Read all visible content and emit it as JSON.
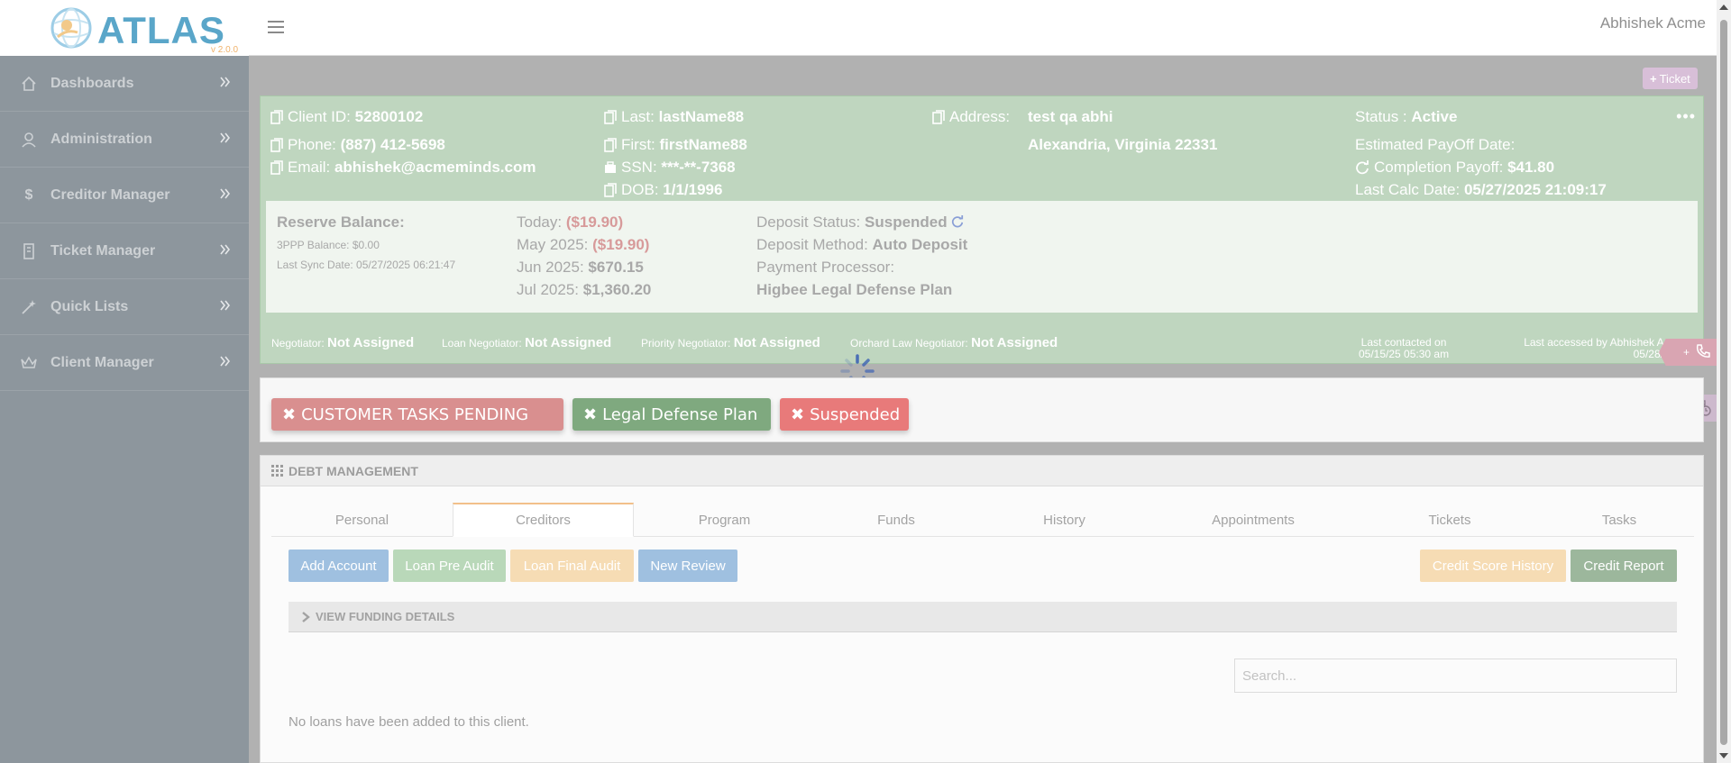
{
  "app": {
    "logo_text": "ATLAS",
    "version": "v 2.0.0"
  },
  "topbar": {
    "user_name": "Abhishek Acme"
  },
  "sidebar": {
    "items": [
      {
        "label": "Dashboards",
        "icon": "home-icon"
      },
      {
        "label": "Administration",
        "icon": "user-icon"
      },
      {
        "label": "Creditor Manager",
        "icon": "dollar-icon"
      },
      {
        "label": "Ticket Manager",
        "icon": "building-icon"
      },
      {
        "label": "Quick Lists",
        "icon": "magic-wand-icon"
      },
      {
        "label": "Client Manager",
        "icon": "crown-icon"
      }
    ]
  },
  "ticket_button": "Ticket",
  "client": {
    "client_id_label": "Client ID:",
    "client_id": "52800102",
    "phone_label": "Phone:",
    "phone": "(887) 412-5698",
    "email_label": "Email:",
    "email": "abhishek@acmeminds.com",
    "last_label": "Last:",
    "last": "lastName88",
    "first_label": "First:",
    "first": "firstName88",
    "ssn_label": "SSN:",
    "ssn": "***-**-7368",
    "dob_label": "DOB:",
    "dob": "1/1/1996",
    "address_label": "Address:",
    "address_line1": "test qa abhi",
    "address_line2": "Alexandria, Virginia 22331",
    "status_label": "Status :",
    "status": "Active",
    "payoff_label": "Estimated PayOff Date:",
    "completion_label": "Completion Payoff:",
    "completion": "$41.80",
    "last_calc_label": "Last Calc Date:",
    "last_calc": "05/27/2025 21:09:17"
  },
  "balances": {
    "reserve_label": "Reserve Balance:",
    "ppp_balance": "3PPP Balance: $0.00",
    "last_sync": "Last Sync Date: 05/27/2025 06:21:47",
    "today_label": "Today:",
    "today": "($19.90)",
    "may_label": "May 2025:",
    "may": "($19.90)",
    "jun_label": "Jun 2025:",
    "jun": "$670.15",
    "jul_label": "Jul 2025:",
    "jul": "$1,360.20",
    "deposit_status_label": "Deposit Status:",
    "deposit_status": "Suspended",
    "deposit_method_label": "Deposit Method:",
    "deposit_method": "Auto Deposit",
    "processor_label": "Payment Processor:",
    "processor": "Higbee Legal Defense Plan"
  },
  "negotiators": {
    "neg_label": "Negotiator:",
    "neg": "Not Assigned",
    "loan_label": "Loan Negotiator:",
    "loan": "Not Assigned",
    "priority_label": "Priority Negotiator:",
    "priority": "Not Assigned",
    "orchard_label": "Orchard Law Negotiator:",
    "orchard": "Not Assigned",
    "last_contacted_label": "Last contacted on",
    "last_contacted": "05/15/25 05:30 am",
    "last_accessed_label": "Last accessed by Abhishek Acme on",
    "last_accessed": "05/28/25 02:3"
  },
  "status_buttons": {
    "pending": "CUSTOMER TASKS PENDING",
    "plan": "Legal Defense Plan",
    "suspended": "Suspended"
  },
  "debt": {
    "header": "DEBT MANAGEMENT",
    "tabs": [
      "Personal",
      "Creditors",
      "Program",
      "Funds",
      "History",
      "Appointments",
      "Tickets",
      "Tasks"
    ],
    "active_tab": "Creditors",
    "buttons": {
      "add_account": "Add Account",
      "loan_pre_audit": "Loan Pre Audit",
      "loan_final_audit": "Loan Final Audit",
      "new_review": "New Review",
      "credit_score_history": "Credit Score History",
      "credit_report": "Credit Report"
    },
    "funding_label": "VIEW FUNDING DETAILS",
    "search_placeholder": "Search...",
    "empty_message": "No loans have been added to this client."
  },
  "colors": {
    "sidebar_bg": "#8d969d",
    "client_panel_bg": "#bfd6bf",
    "btn_blue": "#9fc0e0",
    "btn_green": "#b9d8b9",
    "btn_orange": "#f6dcb4",
    "btn_dark_green": "#9cb79c",
    "pending_red": "#d98f8f",
    "plan_green": "#7fa97f",
    "suspended_red": "#e87a7a"
  }
}
